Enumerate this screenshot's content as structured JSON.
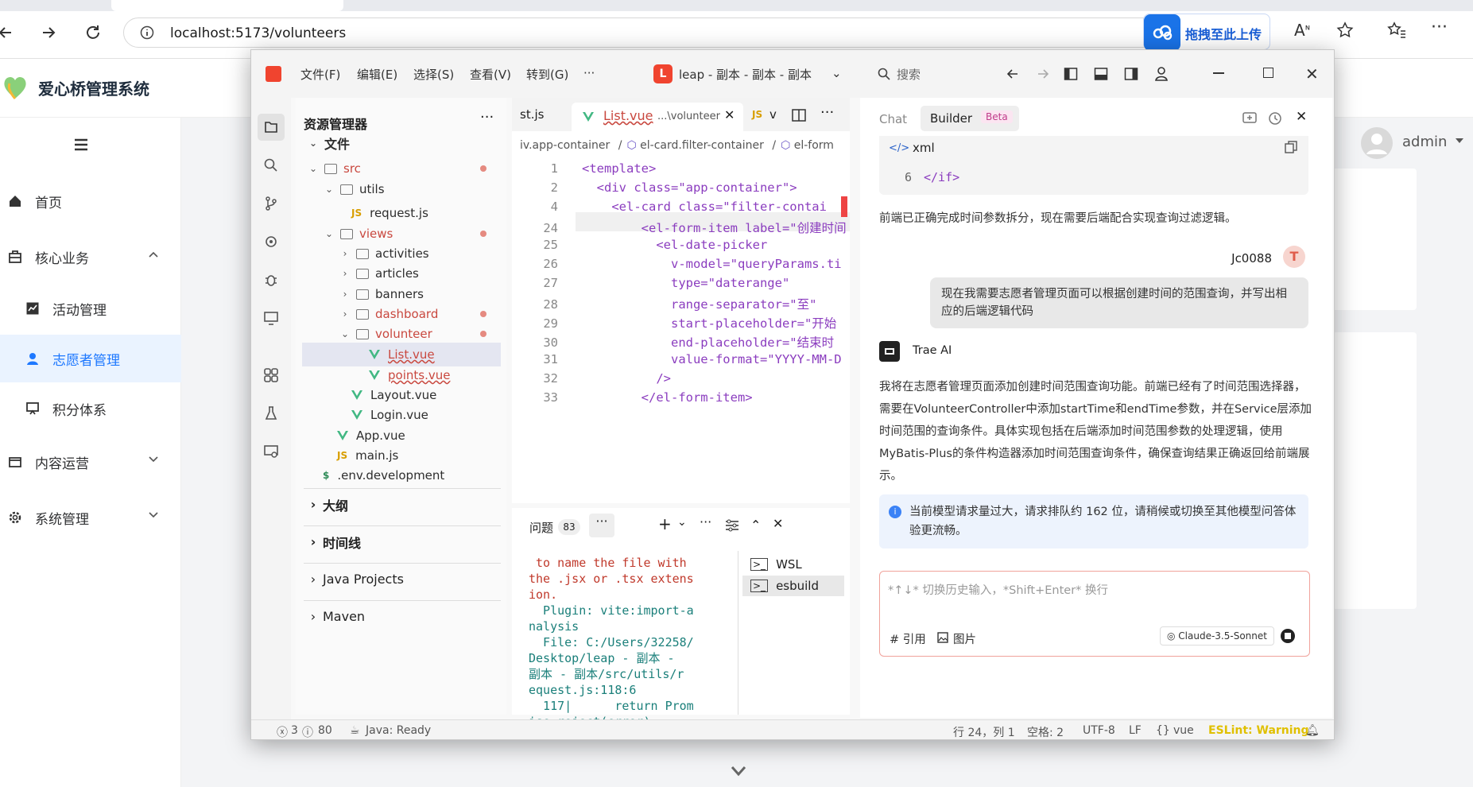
{
  "browser": {
    "url": "localhost:5173/volunteers",
    "upload_label": "拖拽至此上传"
  },
  "app": {
    "title": "爱心桥管理系统",
    "user": "admin",
    "menu": [
      {
        "label": "首页"
      },
      {
        "label": "核心业务"
      },
      {
        "label": "活动管理"
      },
      {
        "label": "志愿者管理"
      },
      {
        "label": "积分体系"
      },
      {
        "label": "内容运营"
      },
      {
        "label": "系统管理"
      }
    ]
  },
  "ide": {
    "menus": [
      "文件(F)",
      "编辑(E)",
      "选择(S)",
      "查看(V)",
      "转到(G)",
      "···"
    ],
    "project": "leap - 副本 - 副本 - 副本",
    "search": "搜索",
    "explorer": {
      "title": "资源管理器",
      "root": "文件",
      "items": [
        "src",
        "utils",
        "request.js",
        "views",
        "activities",
        "articles",
        "banners",
        "dashboard",
        "volunteer",
        "List.vue",
        "points.vue",
        "Layout.vue",
        "Login.vue",
        "App.vue",
        "main.js",
        ".env.development"
      ],
      "sections": [
        "大纲",
        "时间线",
        "Java Projects",
        "Maven"
      ]
    },
    "tabs": {
      "prev": "st.js",
      "active": "List.vue",
      "active_path": "...\\volunteer",
      "next_icon": "JS",
      "next": "v"
    },
    "breadcrumb": [
      "iv.app-container",
      "el-card.filter-container",
      "el-form"
    ],
    "code": [
      {
        "ln": "1",
        "text": "<template>"
      },
      {
        "ln": "2",
        "text": "  <div class=\"app-container\">"
      },
      {
        "ln": "4",
        "text": "    <el-card class=\"filter-contai"
      },
      {
        "ln": "24",
        "text": "        <el-form-item label=\"创建时间"
      },
      {
        "ln": "25",
        "text": "          <el-date-picker"
      },
      {
        "ln": "26",
        "text": "            v-model=\"queryParams.ti"
      },
      {
        "ln": "27",
        "text": "            type=\"daterange\""
      },
      {
        "ln": "28",
        "text": "            range-separator=\"至\""
      },
      {
        "ln": "29",
        "text": "            start-placeholder=\"开始"
      },
      {
        "ln": "30",
        "text": "            end-placeholder=\"结束时"
      },
      {
        "ln": "31",
        "text": "            value-format=\"YYYY-MM-D"
      },
      {
        "ln": "32",
        "text": "          />"
      },
      {
        "ln": "33",
        "text": "        </el-form-item>"
      }
    ],
    "panel": {
      "title": "问题",
      "count": "83",
      "terminal": [
        " to name the file with",
        "the .jsx or .tsx extens",
        "ion.",
        "  Plugin: vite:import-a",
        "nalysis",
        "  File: C:/Users/32258/",
        "Desktop/leap - 副本 -",
        "副本 - 副本/src/utils/r",
        "equest.js:118:6",
        "  117|      return Prom",
        "ise.reject(error)"
      ],
      "shells": [
        "WSL",
        "esbuild"
      ]
    },
    "chat": {
      "tab_chat": "Chat",
      "tab_builder": "Builder",
      "beta": "Beta",
      "code_lang": "xml",
      "code_ln": "6",
      "code_text": "</if>",
      "msg1": "前端已正确完成时间参数拆分，现在需要后端配合实现查询过滤逻辑。",
      "user_name": "Jc0088",
      "user_msg": "现在我需要志愿者管理页面可以根据创建时间的范围查询，并写出相应的后端逻辑代码",
      "ai_name": "Trae AI",
      "ai_msg": "我将在志愿者管理页面添加创建时间范围查询功能。前端已经有了时间范围选择器，需要在VolunteerController中添加startTime和endTime参数，并在Service层添加时间范围的查询条件。具体实现包括在后端添加时间范围参数的处理逻辑，使用MyBatis-Plus的条件构造器添加时间范围查询条件，确保查询结果正确返回给前端展示。",
      "notice": "当前模型请求量过大，请求排队约 162 位，请稍候或切换至其他模型问答体验更流畅。",
      "input_placeholder": "*↑↓* 切换历史输入，*Shift+Enter* 换行",
      "ref_label": "# 引用",
      "img_label": "图片",
      "model": "Claude-3.5-Sonnet"
    },
    "status": {
      "errors": "3",
      "warnings": "80",
      "java": "Java: Ready",
      "pos": "行 24，列 1",
      "spaces": "空格: 2",
      "encoding": "UTF-8",
      "eol": "LF",
      "lang": "vue",
      "linter": "ESLint: Warning"
    }
  }
}
